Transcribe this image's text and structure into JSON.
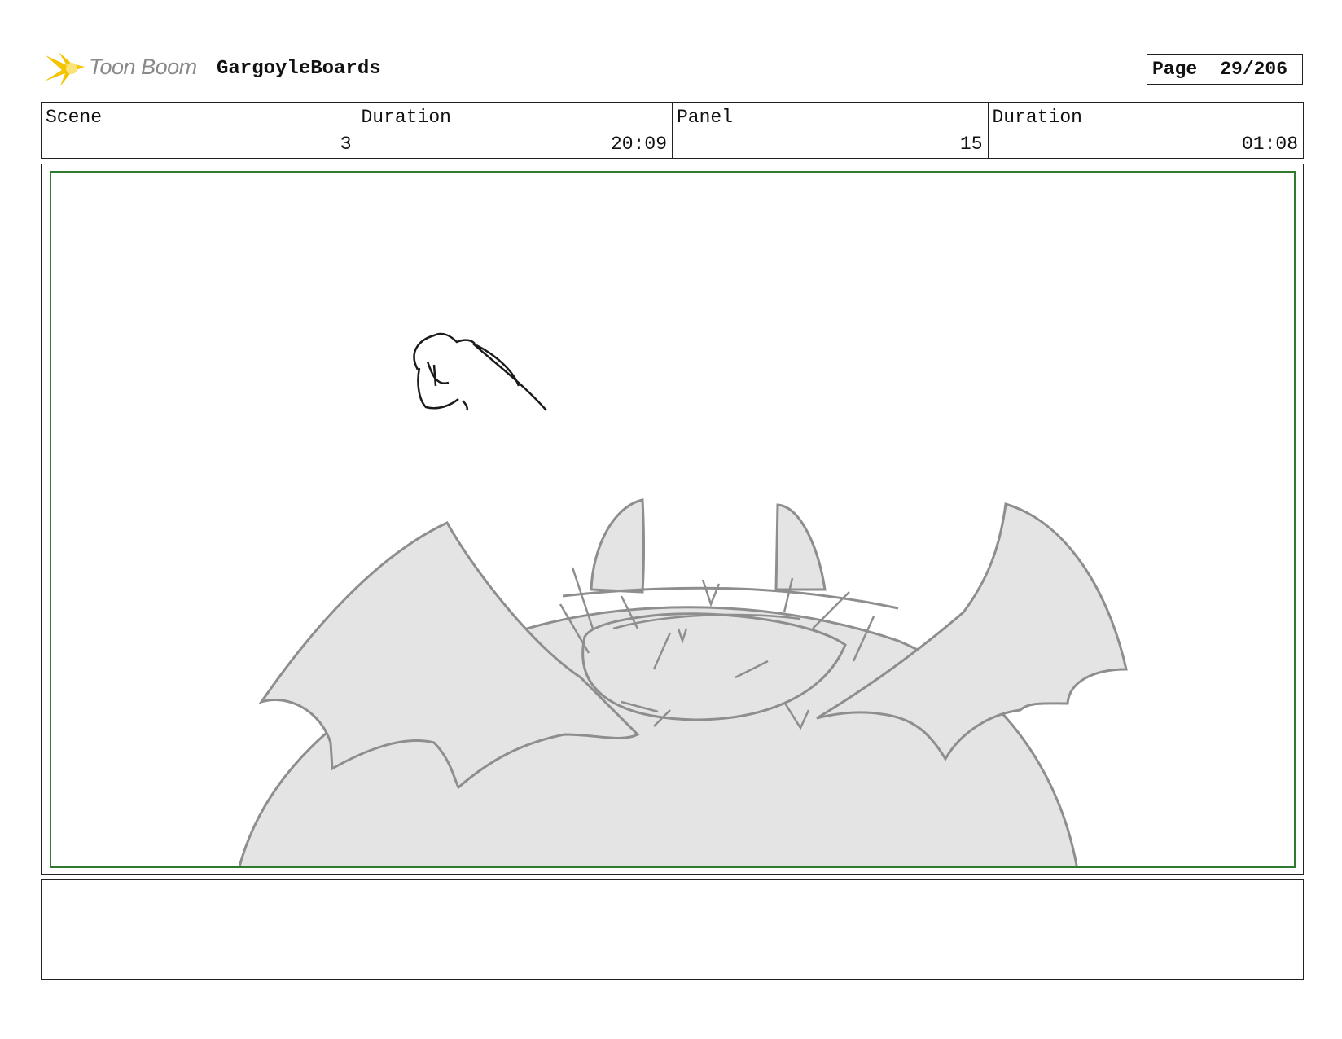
{
  "header": {
    "logo_text": "Toon Boom",
    "project_name": "GargoyleBoards",
    "page_label": "Page",
    "page_value": "29/206"
  },
  "info": {
    "scene_label": "Scene",
    "scene_value": "3",
    "scene_duration_label": "Duration",
    "scene_duration_value": "20:09",
    "panel_label": "Panel",
    "panel_value": "15",
    "panel_duration_label": "Duration",
    "panel_duration_value": "01:08"
  },
  "notes": {
    "text": ""
  },
  "colors": {
    "frame_border": "#2f7a2f",
    "logo_accent": "#f5c400",
    "sketch_fill": "#e4e4e4",
    "sketch_stroke": "#8e8e8e"
  }
}
